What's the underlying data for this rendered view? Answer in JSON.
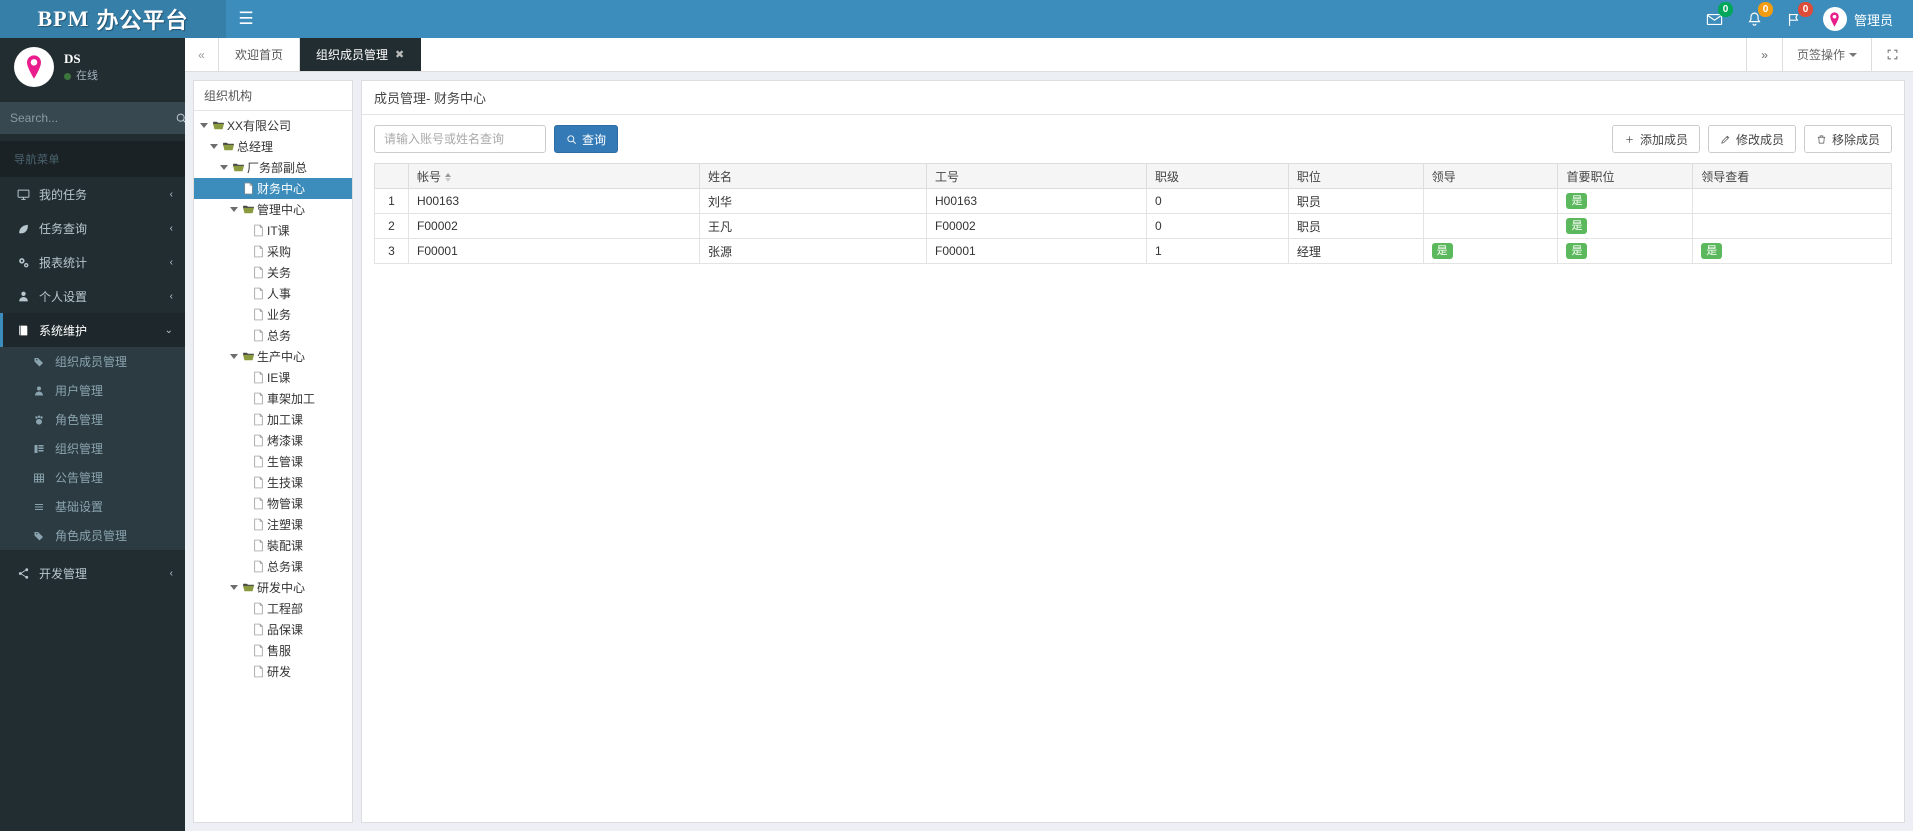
{
  "app": {
    "brand_bpm": "BPM",
    "brand_rest": "办公平台",
    "accent": "#3c8dbc",
    "sidebar_bg": "#222d32",
    "success": "#5cb85c"
  },
  "topbar": {
    "menu_toggle": "hamburger-icon",
    "icons": [
      {
        "name": "envelope-icon",
        "count": "0",
        "badge_color": "#00a65a"
      },
      {
        "name": "bell-icon",
        "count": "0",
        "badge_color": "#f39c12"
      },
      {
        "name": "flag-icon",
        "count": "0",
        "badge_color": "#dd4b39"
      }
    ],
    "user": "管理员"
  },
  "sidebar": {
    "user": {
      "name": "DS",
      "status": "在线"
    },
    "search_placeholder": "Search...",
    "search_value": "",
    "nav_header": "导航菜单",
    "items": [
      {
        "label": "我的任务",
        "icon": "monitor-icon",
        "arrow": "‹",
        "active": false
      },
      {
        "label": "任务查询",
        "icon": "leaf-icon",
        "arrow": "‹",
        "active": false
      },
      {
        "label": "报表统计",
        "icon": "gears-icon",
        "arrow": "‹",
        "active": false
      },
      {
        "label": "个人设置",
        "icon": "user-icon",
        "arrow": "‹",
        "active": false
      },
      {
        "label": "系统维护",
        "icon": "book-icon",
        "arrow": "⌄",
        "active": true
      }
    ],
    "submenu": [
      {
        "label": "组织成员管理",
        "icon": "tag-icon"
      },
      {
        "label": "用户管理",
        "icon": "user-icon"
      },
      {
        "label": "角色管理",
        "icon": "paw-icon"
      },
      {
        "label": "组织管理",
        "icon": "table-columns-icon"
      },
      {
        "label": "公告管理",
        "icon": "grid-icon"
      },
      {
        "label": "基础设置",
        "icon": "list-icon"
      },
      {
        "label": "角色成员管理",
        "icon": "tag-icon"
      }
    ],
    "items_after": [
      {
        "label": "开发管理",
        "icon": "share-icon",
        "arrow": "‹",
        "active": false
      }
    ]
  },
  "tabbar": {
    "prev_icon": "double-chevron-left-icon",
    "next_icon": "double-chevron-right-icon",
    "tabs": [
      {
        "label": "欢迎首页",
        "active": false,
        "closable": false
      },
      {
        "label": "组织成员管理",
        "active": true,
        "closable": true,
        "close": "✖"
      }
    ],
    "tab_ops_label": "页签操作",
    "fullscreen_icon": "expand-icon"
  },
  "tree": {
    "title": "组织机构",
    "nodes": [
      {
        "label": "XX有限公司",
        "depth": 0,
        "type": "folder",
        "expandable": true,
        "selected": false
      },
      {
        "label": "总经理",
        "depth": 1,
        "type": "folder",
        "expandable": true,
        "selected": false
      },
      {
        "label": "厂务部副总",
        "depth": 2,
        "type": "folder",
        "expandable": true,
        "selected": false
      },
      {
        "label": "财务中心",
        "depth": 3,
        "type": "file",
        "expandable": false,
        "selected": true
      },
      {
        "label": "管理中心",
        "depth": 3,
        "type": "folder",
        "expandable": true,
        "selected": false
      },
      {
        "label": "IT课",
        "depth": 4,
        "type": "file",
        "expandable": false,
        "selected": false
      },
      {
        "label": "采购",
        "depth": 4,
        "type": "file",
        "expandable": false,
        "selected": false
      },
      {
        "label": "关务",
        "depth": 4,
        "type": "file",
        "expandable": false,
        "selected": false
      },
      {
        "label": "人事",
        "depth": 4,
        "type": "file",
        "expandable": false,
        "selected": false
      },
      {
        "label": "业务",
        "depth": 4,
        "type": "file",
        "expandable": false,
        "selected": false
      },
      {
        "label": "总务",
        "depth": 4,
        "type": "file",
        "expandable": false,
        "selected": false
      },
      {
        "label": "生产中心",
        "depth": 3,
        "type": "folder",
        "expandable": true,
        "selected": false
      },
      {
        "label": "IE课",
        "depth": 4,
        "type": "file",
        "expandable": false,
        "selected": false
      },
      {
        "label": "車架加工",
        "depth": 4,
        "type": "file",
        "expandable": false,
        "selected": false
      },
      {
        "label": "加工课",
        "depth": 4,
        "type": "file",
        "expandable": false,
        "selected": false
      },
      {
        "label": "烤漆课",
        "depth": 4,
        "type": "file",
        "expandable": false,
        "selected": false
      },
      {
        "label": "生管课",
        "depth": 4,
        "type": "file",
        "expandable": false,
        "selected": false
      },
      {
        "label": "生技课",
        "depth": 4,
        "type": "file",
        "expandable": false,
        "selected": false
      },
      {
        "label": "物管课",
        "depth": 4,
        "type": "file",
        "expandable": false,
        "selected": false
      },
      {
        "label": "注塑课",
        "depth": 4,
        "type": "file",
        "expandable": false,
        "selected": false
      },
      {
        "label": "裝配课",
        "depth": 4,
        "type": "file",
        "expandable": false,
        "selected": false
      },
      {
        "label": "总务课",
        "depth": 4,
        "type": "file",
        "expandable": false,
        "selected": false
      },
      {
        "label": "研发中心",
        "depth": 3,
        "type": "folder",
        "expandable": true,
        "selected": false
      },
      {
        "label": "工程部",
        "depth": 4,
        "type": "file",
        "expandable": false,
        "selected": false
      },
      {
        "label": "品保课",
        "depth": 4,
        "type": "file",
        "expandable": false,
        "selected": false
      },
      {
        "label": "售服",
        "depth": 4,
        "type": "file",
        "expandable": false,
        "selected": false
      },
      {
        "label": "研发",
        "depth": 4,
        "type": "file",
        "expandable": false,
        "selected": false
      }
    ]
  },
  "main": {
    "title": "成员管理- 财务中心",
    "search": {
      "placeholder": "请输入账号或姓名查询",
      "value": ""
    },
    "query_button": "查询",
    "buttons": [
      {
        "label": "添加成员",
        "icon": "plus-icon"
      },
      {
        "label": "修改成员",
        "icon": "pencil-icon"
      },
      {
        "label": "移除成员",
        "icon": "trash-icon"
      }
    ],
    "table": {
      "columns": [
        {
          "label": "帐号",
          "sortable": true
        },
        {
          "label": "姓名",
          "sortable": false
        },
        {
          "label": "工号",
          "sortable": false
        },
        {
          "label": "职级",
          "sortable": false
        },
        {
          "label": "职位",
          "sortable": false
        },
        {
          "label": "领导",
          "sortable": false
        },
        {
          "label": "首要职位",
          "sortable": false
        },
        {
          "label": "领导查看",
          "sortable": false
        }
      ],
      "rows": [
        {
          "index": "1",
          "account": "H00163",
          "name": "刘华",
          "emp_no": "H00163",
          "level": "0",
          "position": "职员",
          "leader": "",
          "primary": "是",
          "leader_view": ""
        },
        {
          "index": "2",
          "account": "F00002",
          "name": "王凡",
          "emp_no": "F00002",
          "level": "0",
          "position": "职员",
          "leader": "",
          "primary": "是",
          "leader_view": ""
        },
        {
          "index": "3",
          "account": "F00001",
          "name": "张源",
          "emp_no": "F00001",
          "level": "1",
          "position": "经理",
          "leader": "是",
          "primary": "是",
          "leader_view": "是"
        }
      ]
    }
  }
}
